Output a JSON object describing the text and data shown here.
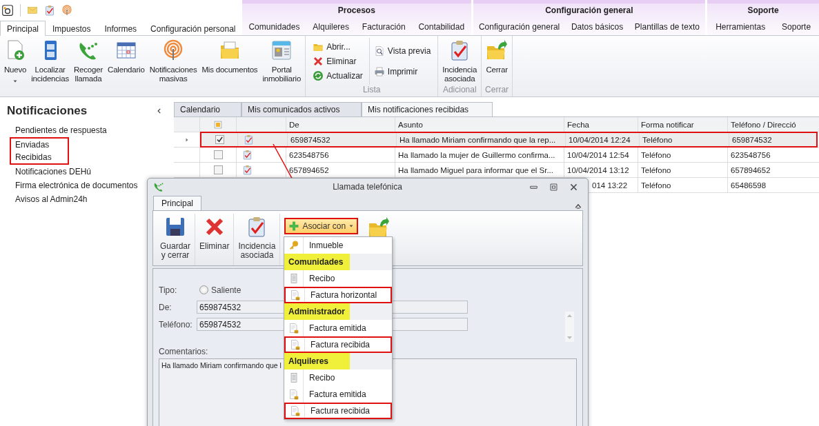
{
  "ribbon_tabs": [
    {
      "label": "Principal",
      "selected": true
    },
    {
      "label": "Impuestos",
      "selected": false
    },
    {
      "label": "Informes",
      "selected": false
    },
    {
      "label": "Configuración personal",
      "selected": false
    }
  ],
  "context_groups": [
    {
      "title": "Procesos",
      "tabs": [
        {
          "label": "Comunidades",
          "selected": false
        },
        {
          "label": "Alquileres",
          "selected": false
        },
        {
          "label": "Facturación",
          "selected": false
        },
        {
          "label": "Contabilidad",
          "selected": false
        }
      ]
    },
    {
      "title": "Configuración general",
      "tabs": [
        {
          "label": "Configuración general",
          "selected": false
        },
        {
          "label": "Datos básicos",
          "selected": false
        },
        {
          "label": "Plantillas de texto",
          "selected": false
        }
      ]
    },
    {
      "title": "Soporte",
      "tabs": [
        {
          "label": "Herramientas",
          "selected": false
        },
        {
          "label": "Soporte",
          "selected": false
        }
      ]
    }
  ],
  "ribbon_groups": [
    {
      "kind": "large",
      "items": [
        {
          "label": "Nuevo",
          "dropdown": true
        },
        {
          "label": "Localizar\nincidencias",
          "dropdown": false
        },
        {
          "label": "Recoger\nllamada",
          "dropdown": false
        },
        {
          "label": "Calendario",
          "dropdown": false
        },
        {
          "label": "Notificaciones\nmasivas",
          "dropdown": false
        },
        {
          "label": "Mis documentos",
          "dropdown": false
        },
        {
          "label": "Portal\ninmobiliario",
          "dropdown": false
        }
      ]
    },
    {
      "kind": "small",
      "label": "Lista",
      "columns": [
        [
          "Abrir...",
          "Eliminar",
          "Actualizar"
        ],
        [
          "Vista previa",
          "Imprimir"
        ]
      ]
    },
    {
      "kind": "large",
      "label": "Adicional",
      "items": [
        {
          "label": "Incidencia\nasociada",
          "dropdown": false
        }
      ]
    },
    {
      "kind": "large",
      "label": "Cerrar",
      "items": [
        {
          "label": "Cerrar",
          "dropdown": false
        }
      ]
    }
  ],
  "sidebar": {
    "title": "Notificaciones",
    "items": [
      {
        "label": "Pendientes de respuesta",
        "highlighted": false
      },
      {
        "label": "Enviadas",
        "highlighted": true
      },
      {
        "label": "Recibidas",
        "highlighted": true
      },
      {
        "label": "Notificaciones DEHú",
        "highlighted": false
      },
      {
        "label": "Firma electrónica de documentos",
        "highlighted": false
      },
      {
        "label": "Avisos al Admin24h",
        "highlighted": false
      }
    ]
  },
  "document_tabs": [
    {
      "label": "Calendario",
      "selected": false
    },
    {
      "label": "Mis comunicados activos",
      "selected": false
    },
    {
      "label": "Mis notificaciones recibidas",
      "selected": true
    }
  ],
  "grid": {
    "columns": [
      "De",
      "Asunto",
      "Fecha",
      "Forma notificar",
      "Teléfono / Direcció"
    ],
    "rows": [
      {
        "selected": true,
        "highlighted": true,
        "checked": true,
        "cells": [
          "659874532",
          "Ha llamado Miriam confirmando que la rep...",
          "10/04/2014 12:24",
          "Teléfono",
          "659874532"
        ]
      },
      {
        "selected": false,
        "highlighted": false,
        "checked": false,
        "cells": [
          "623548756",
          "Ha llamado la mujer de Guillermo confirma...",
          "10/04/2014 12:54",
          "Teléfono",
          "623548756"
        ]
      },
      {
        "selected": false,
        "highlighted": false,
        "checked": false,
        "cells": [
          "657894652",
          "Ha llamado Miguel para informar que el Sr...",
          "10/04/2014 13:12",
          "Teléfono",
          "657894652"
        ]
      },
      {
        "cells": [
          "",
          "",
          "014 13:22",
          "Teléfono",
          "65486598"
        ]
      }
    ]
  },
  "dialog": {
    "title": "Llamada telefónica",
    "tabs": [
      {
        "label": "Principal",
        "selected": true
      }
    ],
    "ribbon": [
      {
        "kind": "large",
        "label": "Guardar\ny cerrar"
      },
      {
        "kind": "large",
        "label": "Eliminar"
      },
      {
        "kind": "large",
        "label": "Incidencia\nasociada"
      },
      {
        "kind": "dropdown",
        "label": "Asociar con",
        "highlighted": true
      },
      {
        "kind": "icon"
      }
    ],
    "form": {
      "type_label": "Tipo:",
      "type_option": {
        "label": "Saliente",
        "selected": false
      },
      "fields": [
        {
          "label": "De:",
          "value": "659874532"
        },
        {
          "label": "Teléfono:",
          "value": "659874532"
        }
      ],
      "comments_label": "Comentarios:",
      "comments": "Ha llamado Miriam confirmando que l"
    },
    "menu": [
      {
        "kind": "item",
        "label": "Inmueble",
        "highlighted": false
      },
      {
        "kind": "header",
        "label": "Comunidades"
      },
      {
        "kind": "item",
        "label": "Recibo",
        "highlighted": false
      },
      {
        "kind": "item",
        "label": "Factura horizontal",
        "highlighted": true
      },
      {
        "kind": "header",
        "label": "Administrador"
      },
      {
        "kind": "item",
        "label": "Factura emitida",
        "highlighted": false
      },
      {
        "kind": "item",
        "label": "Factura recibida",
        "highlighted": true
      },
      {
        "kind": "header",
        "label": "Alquileres"
      },
      {
        "kind": "item",
        "label": "Recibo",
        "highlighted": false
      },
      {
        "kind": "item",
        "label": "Factura emitida",
        "highlighted": false
      },
      {
        "kind": "item",
        "label": "Factura recibida",
        "highlighted": true
      }
    ]
  }
}
